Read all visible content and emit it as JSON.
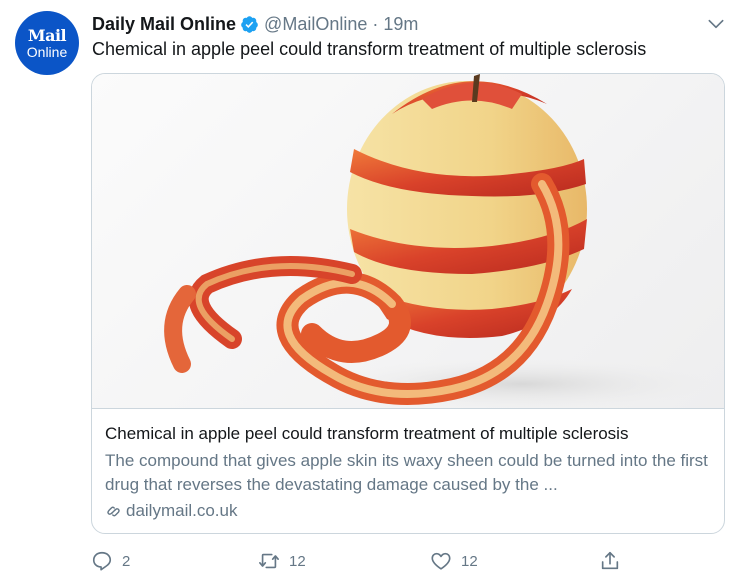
{
  "account": {
    "avatar_line1": "Mail",
    "avatar_line2": "Online",
    "name": "Daily Mail Online",
    "handle": "@MailOnline",
    "separator": "·",
    "time": "19m"
  },
  "tweet": {
    "text": "Chemical in apple peel could transform treatment of multiple sclerosis"
  },
  "card": {
    "title": "Chemical in apple peel could transform treatment of multiple sclerosis",
    "description": "The compound that gives apple skin its waxy sheen could be turned into the first drug that reverses the devastating damage caused by the ...",
    "domain": "dailymail.co.uk"
  },
  "actions": {
    "reply_count": "2",
    "retweet_count": "12",
    "like_count": "12"
  },
  "colors": {
    "brand_blue": "#0b55c7",
    "verified_blue": "#1da1f2",
    "secondary_text": "#657786",
    "border": "#ccd6dd"
  },
  "icons": [
    "mail-online-avatar",
    "verified-badge-icon",
    "chevron-down-icon",
    "link-icon",
    "reply-icon",
    "retweet-icon",
    "like-icon",
    "share-icon"
  ]
}
